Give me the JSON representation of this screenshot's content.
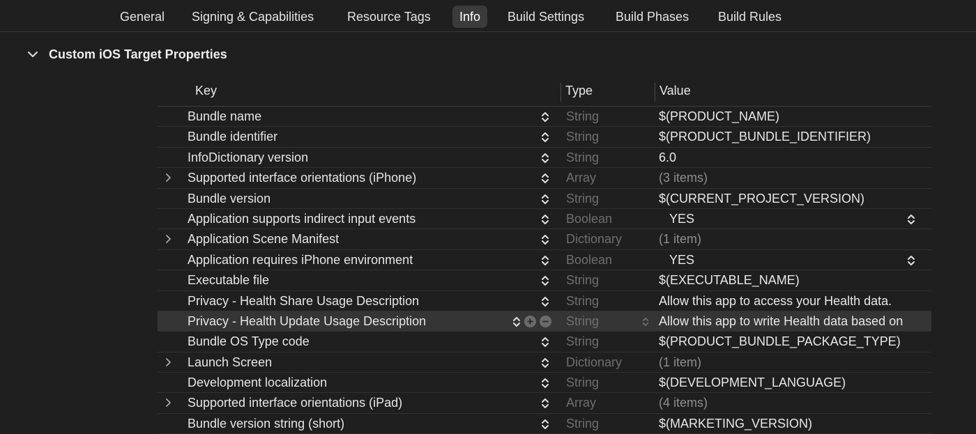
{
  "tabs": [
    {
      "label": "General",
      "active": false
    },
    {
      "label": "Signing & Capabilities",
      "active": false
    },
    {
      "label": "Resource Tags",
      "active": false
    },
    {
      "label": "Info",
      "active": true
    },
    {
      "label": "Build Settings",
      "active": false
    },
    {
      "label": "Build Phases",
      "active": false
    },
    {
      "label": "Build Rules",
      "active": false
    }
  ],
  "section": {
    "title": "Custom iOS Target Properties",
    "expanded": true
  },
  "table": {
    "headers": {
      "key": "Key",
      "type": "Type",
      "value": "Value"
    },
    "rows": [
      {
        "key": "Bundle name",
        "type": "String",
        "value": "$(PRODUCT_NAME)"
      },
      {
        "key": "Bundle identifier",
        "type": "String",
        "value": "$(PRODUCT_BUNDLE_IDENTIFIER)"
      },
      {
        "key": "InfoDictionary version",
        "type": "String",
        "value": "6.0"
      },
      {
        "key": "Supported interface orientations (iPhone)",
        "type": "Array",
        "value": "(3 items)",
        "expandable": true
      },
      {
        "key": "Bundle version",
        "type": "String",
        "value": "$(CURRENT_PROJECT_VERSION)"
      },
      {
        "key": "Application supports indirect input events",
        "type": "Boolean",
        "value": "YES",
        "boolean": true
      },
      {
        "key": "Application Scene Manifest",
        "type": "Dictionary",
        "value": "(1 item)",
        "expandable": true
      },
      {
        "key": "Application requires iPhone environment",
        "type": "Boolean",
        "value": "YES",
        "boolean": true
      },
      {
        "key": "Executable file",
        "type": "String",
        "value": "$(EXECUTABLE_NAME)"
      },
      {
        "key": "Privacy - Health Share Usage Description",
        "type": "String",
        "value": "Allow this app to access your Health data."
      },
      {
        "key": "Privacy - Health Update Usage Description",
        "type": "String",
        "value": "Allow this app to write Health data based on",
        "selected": true
      },
      {
        "key": "Bundle OS Type code",
        "type": "String",
        "value": "$(PRODUCT_BUNDLE_PACKAGE_TYPE)"
      },
      {
        "key": "Launch Screen",
        "type": "Dictionary",
        "value": "(1 item)",
        "expandable": true
      },
      {
        "key": "Development localization",
        "type": "String",
        "value": "$(DEVELOPMENT_LANGUAGE)"
      },
      {
        "key": "Supported interface orientations (iPad)",
        "type": "Array",
        "value": "(4 items)",
        "expandable": true
      },
      {
        "key": "Bundle version string (short)",
        "type": "String",
        "value": "$(MARKETING_VERSION)"
      }
    ]
  },
  "colors": {
    "background": "#1f1f1f",
    "selected_row": "#353535",
    "type_text": "#6f6f6f"
  },
  "icons": {
    "section_toggle": "chevron-down-icon",
    "row_expander": "chevron-right-icon",
    "key_stepper": "up-down-stepper-icon",
    "add": "plus-circle-icon",
    "remove": "minus-circle-icon"
  }
}
